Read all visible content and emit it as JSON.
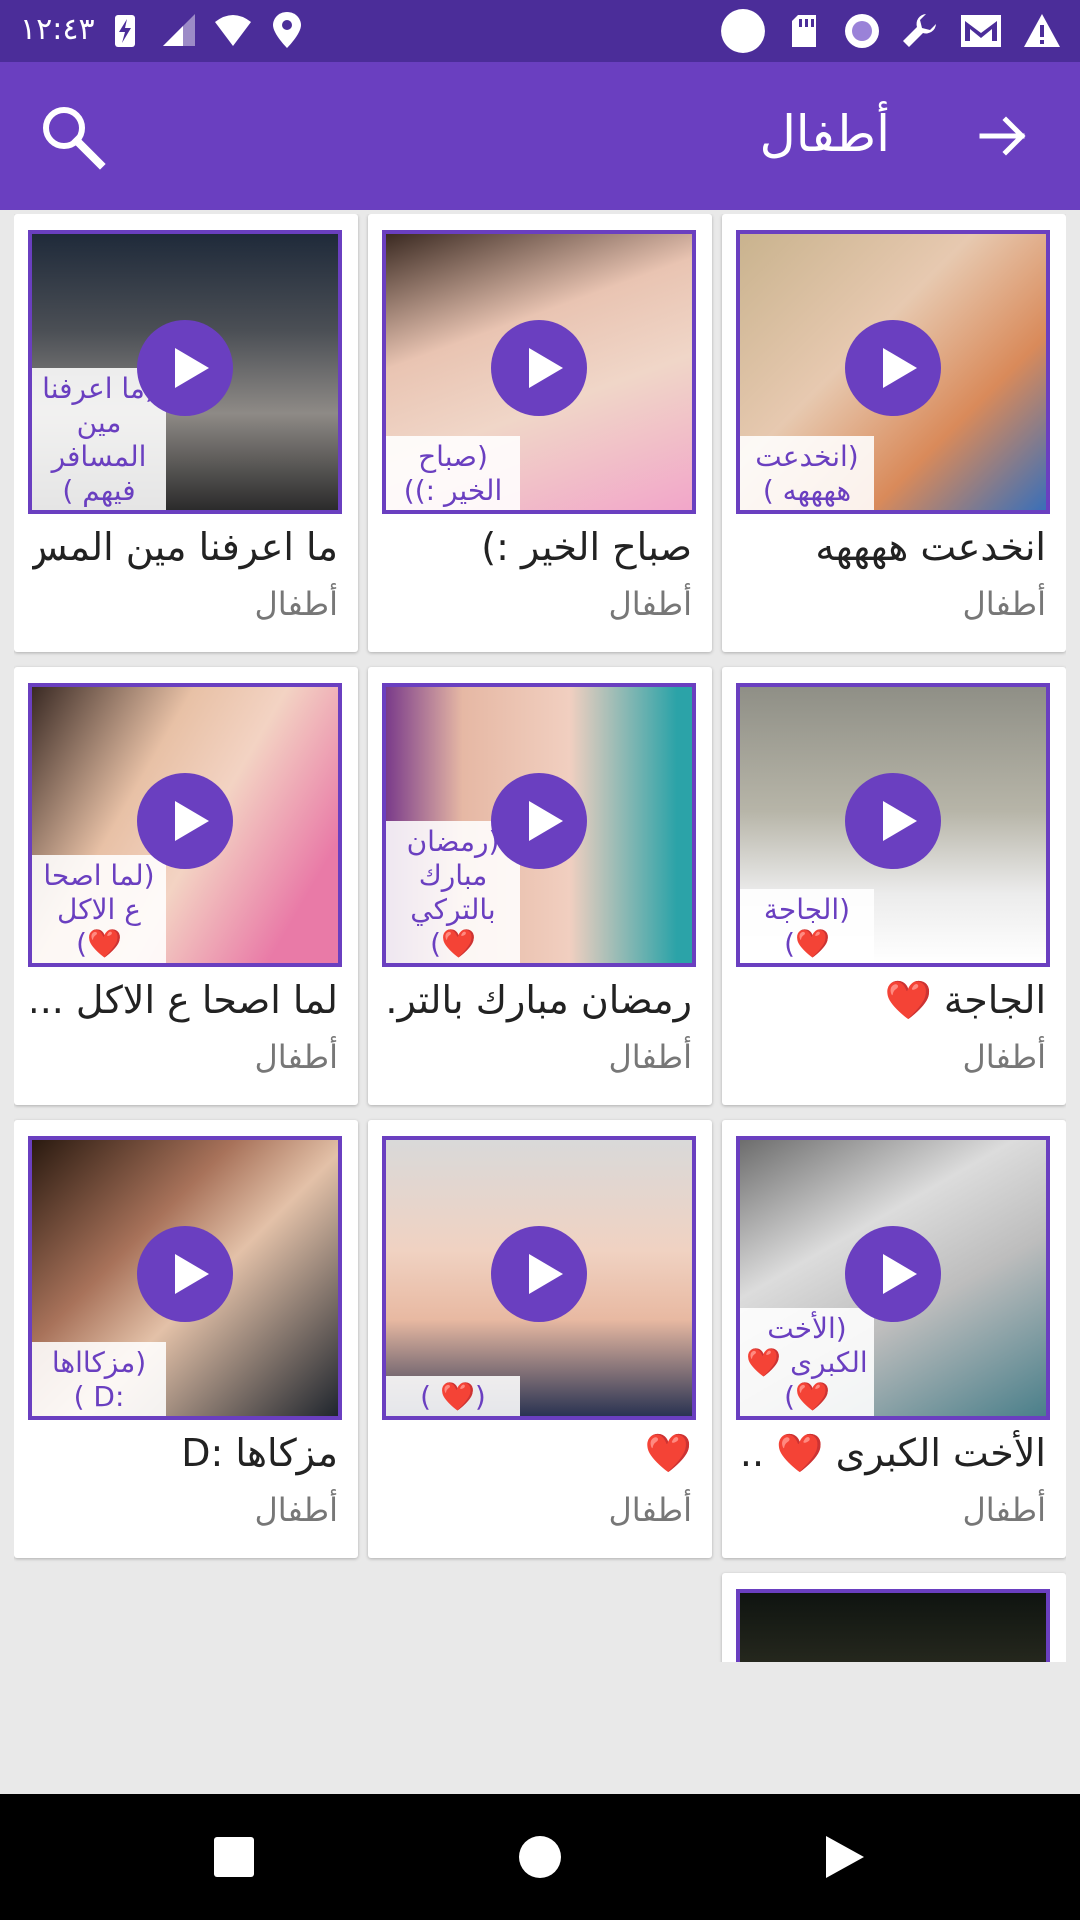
{
  "status_bar": {
    "time": "١٢:٤٣",
    "left_icons": [
      "battery-saver-icon",
      "signal-icon",
      "wifi-icon",
      "location-icon"
    ],
    "right_icons": [
      "record-icon",
      "sd-card-icon",
      "radio-icon",
      "wrench-icon",
      "mail-icon",
      "alert-icon"
    ]
  },
  "app_bar": {
    "title": "أطفال",
    "back_icon": "arrow-right-icon",
    "search_icon": "search-icon",
    "color": "#6a3fc0",
    "status_color": "#4b2d99"
  },
  "videos": [
    {
      "title": "انخدعت ههههه",
      "category": "أطفال",
      "overlay": "(انخدعت ههههه )"
    },
    {
      "title": "صباح الخير :)",
      "category": "أطفال",
      "overlay": "(صباح الخير :))"
    },
    {
      "title": "ما اعرفنا مين المس..",
      "category": "أطفال",
      "overlay": "(ما اعرفنا مين المسافر فيهم )"
    },
    {
      "title": "الجاجة ❤️",
      "category": "أطفال",
      "overlay": "(الجاجة ❤️)"
    },
    {
      "title": "رمضان مبارك بالتر...",
      "category": "أطفال",
      "overlay": "(رمضان مبارك بالتركي ❤️)"
    },
    {
      "title": "لما اصحا ع الاكل ...",
      "category": "أطفال",
      "overlay": "(لما اصحا ع الاكل ❤️)"
    },
    {
      "title": "الأخت الكبرى ❤️ ...",
      "category": "أطفال",
      "overlay": "(الأخت الكبرى ❤️ ❤️)"
    },
    {
      "title": "❤️",
      "category": "أطفال",
      "overlay": "(❤️ )"
    },
    {
      "title": "مزكاها :D",
      "category": "أطفال",
      "overlay": "(مزكااها :D )"
    },
    {
      "title": "",
      "category": "",
      "overlay": ""
    }
  ],
  "nav_bar": {
    "back_icon": "square-icon",
    "home_icon": "circle-icon",
    "recents_icon": "triangle-icon"
  }
}
